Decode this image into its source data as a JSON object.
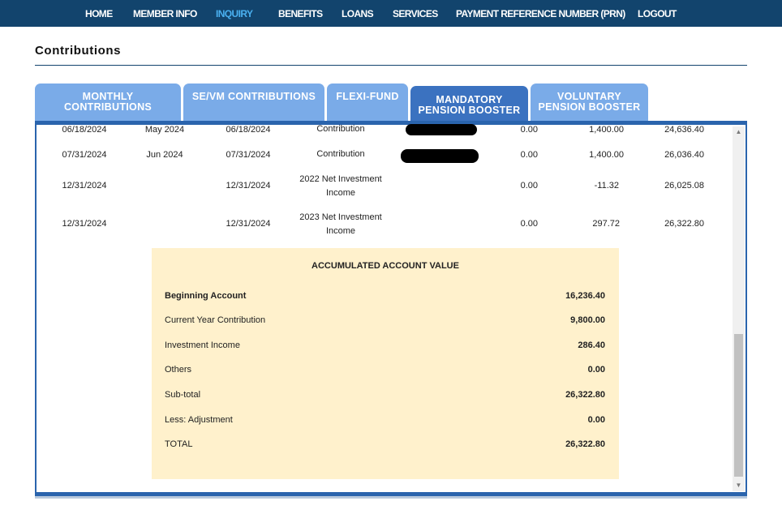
{
  "nav": {
    "items": [
      "HOME",
      "MEMBER INFO",
      "INQUIRY",
      "BENEFITS",
      "LOANS",
      "SERVICES",
      "PAYMENT REFERENCE NUMBER (PRN)",
      "LOGOUT"
    ],
    "active": "INQUIRY"
  },
  "page": {
    "title": "Contributions"
  },
  "tabs": [
    {
      "line1": "MONTHLY",
      "line2": "CONTRIBUTIONS"
    },
    {
      "line1": "SE/VM CONTRIBUTIONS",
      "line2": ""
    },
    {
      "line1": "FLEXI-FUND",
      "line2": ""
    },
    {
      "line1": "MANDATORY",
      "line2": "PENSION BOOSTER"
    },
    {
      "line1": "VOLUNTARY",
      "line2": "PENSION BOOSTER"
    }
  ],
  "active_tab": "MANDATORY PENSION BOOSTER",
  "rows": [
    {
      "date1": "06/18/2024",
      "period": "May 2024",
      "date2": "06/18/2024",
      "desc_line1": "Contribution",
      "desc_line2": "",
      "col1": "0.00",
      "col2": "1,400.00",
      "col3": "24,636.40",
      "redacted": true
    },
    {
      "date1": "07/31/2024",
      "period": "Jun 2024",
      "date2": "07/31/2024",
      "desc_line1": "Contribution",
      "desc_line2": "",
      "col1": "0.00",
      "col2": "1,400.00",
      "col3": "26,036.40",
      "redacted": true
    },
    {
      "date1": "12/31/2024",
      "period": "",
      "date2": "12/31/2024",
      "desc_line1": "2022 Net Investment",
      "desc_line2": "Income",
      "col1": "0.00",
      "col2": "-11.32",
      "col3": "26,025.08",
      "redacted": false
    },
    {
      "date1": "12/31/2024",
      "period": "",
      "date2": "12/31/2024",
      "desc_line1": "2023 Net Investment",
      "desc_line2": "Income",
      "col1": "0.00",
      "col2": "297.72",
      "col3": "26,322.80",
      "redacted": false
    }
  ],
  "accumulated": {
    "title": "ACCUMULATED ACCOUNT VALUE",
    "items": [
      {
        "label": "Beginning Account",
        "value": "16,236.40"
      },
      {
        "label": "Current Year Contribution",
        "value": "9,800.00"
      },
      {
        "label": "Investment Income",
        "value": "286.40"
      },
      {
        "label": "Others",
        "value": "0.00"
      },
      {
        "label": "Sub-total",
        "value": "26,322.80"
      },
      {
        "label": "Less: Adjustment",
        "value": "0.00"
      },
      {
        "label": "TOTAL",
        "value": "26,322.80"
      }
    ]
  },
  "colors": {
    "nav_bg": "#12446d",
    "nav_active": "#4ab0f0",
    "tab_bg": "#7aabe8",
    "tab_active_bg": "#3b72c0",
    "panel_border": "#2a64ad",
    "summary_bg": "#fff1cc"
  }
}
